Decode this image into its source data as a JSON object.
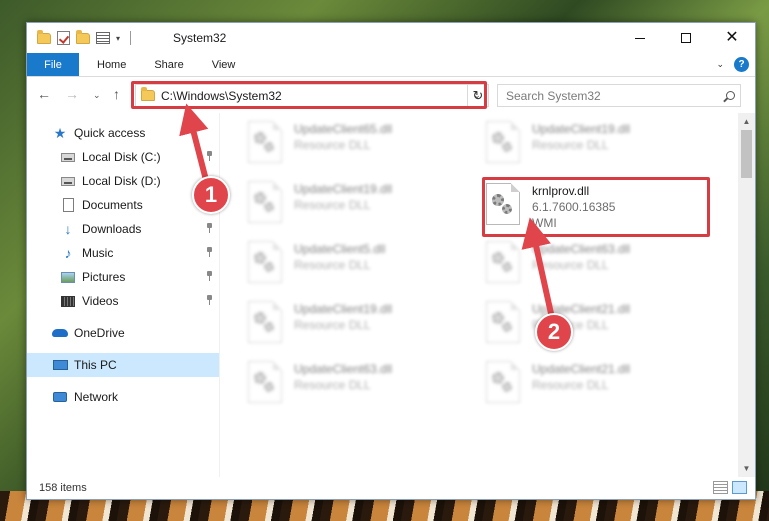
{
  "window": {
    "title": "System32",
    "controls": {
      "minimize": "—",
      "maximize": "☐",
      "close": "✕"
    }
  },
  "ribbon": {
    "tabs": [
      "File",
      "Home",
      "Share",
      "View"
    ],
    "help": "?"
  },
  "address": {
    "path": "C:\\Windows\\System32",
    "search_placeholder": "Search System32"
  },
  "navpane": {
    "quick_access": "Quick access",
    "items": [
      {
        "label": "Local Disk (C:)",
        "icon": "disk-icon",
        "pinned": true
      },
      {
        "label": "Local Disk (D:)",
        "icon": "disk-icon",
        "pinned": false
      },
      {
        "label": "Documents",
        "icon": "document-icon",
        "pinned": true
      },
      {
        "label": "Downloads",
        "icon": "download-icon",
        "pinned": true
      },
      {
        "label": "Music",
        "icon": "music-icon",
        "pinned": true
      },
      {
        "label": "Pictures",
        "icon": "pictures-icon",
        "pinned": true
      },
      {
        "label": "Videos",
        "icon": "videos-icon",
        "pinned": true
      }
    ],
    "onedrive": "OneDrive",
    "this_pc": "This PC",
    "network": "Network"
  },
  "files": {
    "blurred": [
      {
        "name": "UpdateClient65.dll",
        "type": "Resource DLL"
      },
      {
        "name": "UpdateClient19.dll",
        "type": "Resource DLL"
      },
      {
        "name": "UpdateClient19.dll",
        "type": "Resource DLL"
      },
      {
        "name": "UpdateClient5.dll",
        "type": "Resource DLL"
      },
      {
        "name": "UpdateClient63.dll",
        "type": "Resource DLL"
      },
      {
        "name": "UpdateClient19.dll",
        "type": "Resource DLL"
      },
      {
        "name": "UpdateClient21.dll",
        "type": "Resource DLL"
      },
      {
        "name": "UpdateClient63.dll",
        "type": "Resource DLL"
      },
      {
        "name": "UpdateClient21.dll",
        "type": "Resource DLL"
      }
    ],
    "highlighted": {
      "name": "krnlprov.dll",
      "version": "6.1.7600.16385",
      "description": "WMI"
    }
  },
  "status": {
    "item_count": "158 items"
  },
  "callouts": {
    "one": "1",
    "two": "2"
  },
  "colors": {
    "accent": "#1979ca",
    "highlight_red": "#d73c43",
    "callout_red": "#e0454b"
  }
}
